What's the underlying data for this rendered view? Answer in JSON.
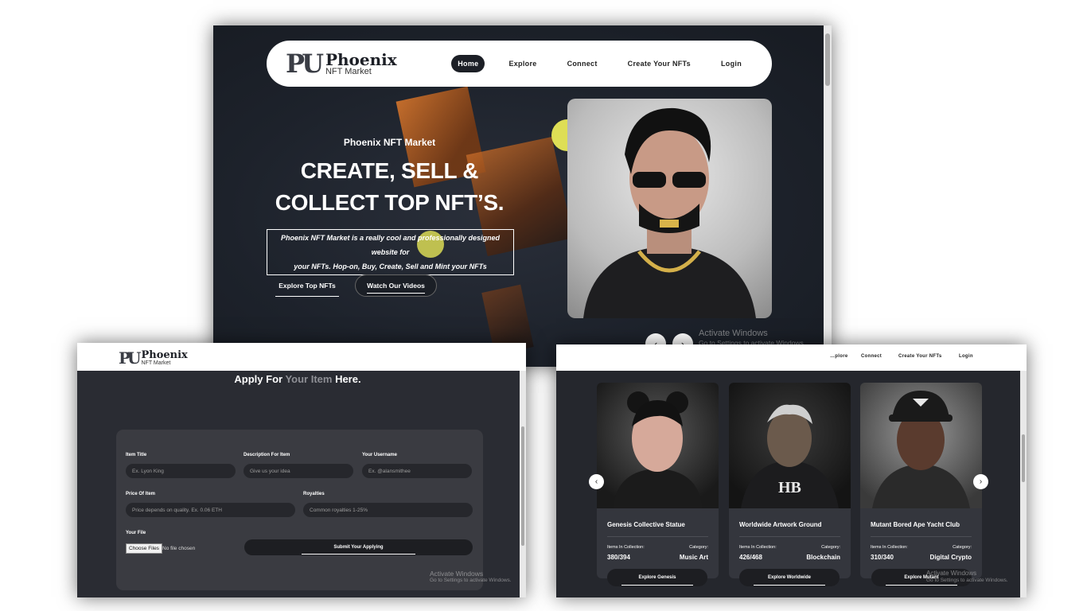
{
  "hero": {
    "logo": {
      "mark": "PU",
      "name": "Phoenix",
      "sub": "NFT Market"
    },
    "nav": [
      "Home",
      "Explore",
      "Connect",
      "Create Your NFTs",
      "Login"
    ],
    "eyebrow": "Phoenix NFT Market",
    "title_line1": "CREATE, SELL &",
    "title_line2": "COLLECT TOP NFT’S.",
    "desc_line1": "Phoenix NFT Market is a really cool and professionally designed website for",
    "desc_line2": "your NFTs. Hop-on, Buy, Create, Sell and Mint your NFTs",
    "cta_primary": "Explore Top NFTs",
    "cta_secondary": "Watch Our Videos",
    "prev": "‹",
    "next": "›"
  },
  "watermark": {
    "line1": "Activate Windows",
    "line2": "Go to Settings to activate Windows."
  },
  "form": {
    "logo_name": "Phoenix",
    "logo_sub": "NFT Market",
    "title_pre": "Apply For ",
    "title_hl": "Your Item",
    "title_post": " Here.",
    "fields": {
      "item_title": {
        "label": "Item Title",
        "placeholder": "Ex. Lyon King"
      },
      "description": {
        "label": "Description For Item",
        "placeholder": "Give us your idea"
      },
      "username": {
        "label": "Your Username",
        "placeholder": "Ex. @alansmithee"
      },
      "price": {
        "label": "Price Of Item",
        "placeholder": "Price depends on quality. Ex. 0.06 ETH"
      },
      "royalties": {
        "label": "Royalties",
        "placeholder": "Common royalties 1-25%"
      },
      "file": {
        "label": "Your File",
        "button": "Choose Files",
        "status": "No file chosen"
      }
    },
    "submit": "Submit Your Applying"
  },
  "collection": {
    "nav_partial": [
      "…plore",
      "Connect",
      "Create Your NFTs",
      "Login"
    ],
    "prev": "‹",
    "next": "›",
    "cards": [
      {
        "name": "Genesis Collective Statue",
        "k1": "Items In Collection:",
        "k2": "Category:",
        "v1": "380/394",
        "v2": "Music Art",
        "button": "Explore Genesis"
      },
      {
        "name": "Worldwide Artwork Ground",
        "k1": "Items In Collection:",
        "k2": "Category:",
        "v1": "426/468",
        "v2": "Blockchain",
        "button": "Explore Worldwide"
      },
      {
        "name": "Mutant Bored Ape Yacht Club",
        "k1": "Items In Collection:",
        "k2": "Category:",
        "v1": "310/340",
        "v2": "Digital Crypto",
        "button": "Explore Mutant"
      }
    ]
  }
}
